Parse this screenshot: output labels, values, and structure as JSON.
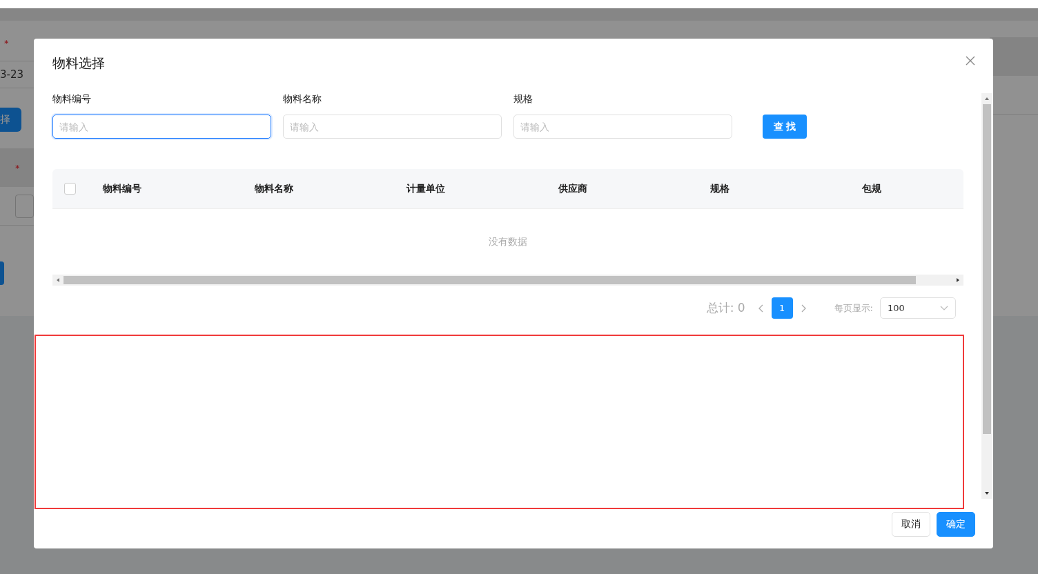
{
  "background_page": {
    "left_required_mark": "*",
    "left_date": "3-23",
    "left_button": "择",
    "table_required_mark": "*"
  },
  "dialog": {
    "title": "物料选择",
    "filters": [
      {
        "label": "物料编号",
        "placeholder": "请输入",
        "focused": true
      },
      {
        "label": "物料名称",
        "placeholder": "请输入",
        "focused": false
      },
      {
        "label": "规格",
        "placeholder": "请输入",
        "focused": false
      }
    ],
    "search_button": "查 找",
    "table": {
      "select_all_checked": false,
      "columns": [
        "物料编号",
        "物料名称",
        "计量单位",
        "供应商",
        "规格",
        "包规"
      ],
      "empty_text": "没有数据"
    },
    "pagination": {
      "total": "总计: 0",
      "pages": [
        {
          "label": "1",
          "selected": true
        }
      ],
      "page_size_label": "每页显示:",
      "page_size": "100"
    },
    "buttons": [
      {
        "label": "取消",
        "kind": "default"
      },
      {
        "label": "确定",
        "kind": "primary"
      }
    ]
  }
}
